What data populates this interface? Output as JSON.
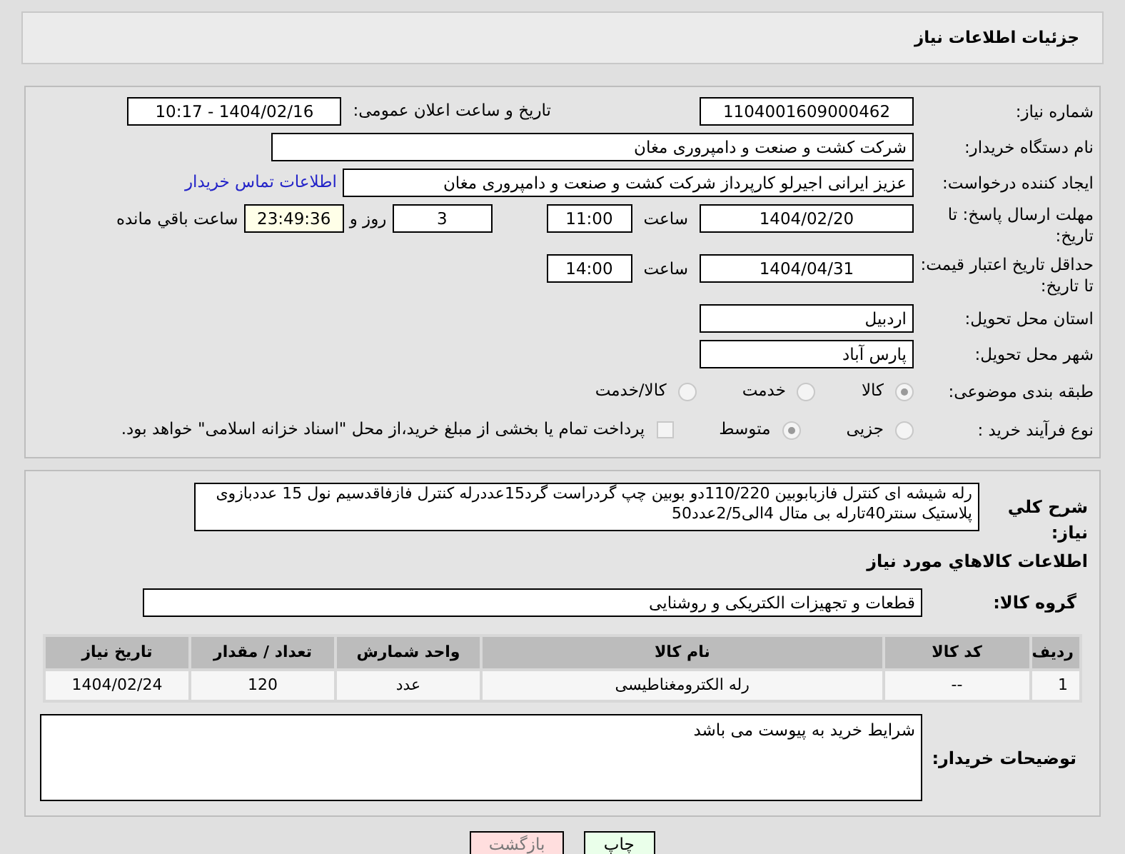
{
  "header": {
    "title": "جزئیات اطلاعات نیاز"
  },
  "need_number": {
    "label": "شماره نیاز:",
    "value": "1104001609000462"
  },
  "announce": {
    "label": "تاریخ و ساعت اعلان عمومی:",
    "value": "1404/02/16 - 10:17"
  },
  "buyer_org": {
    "label": "نام دستگاه خریدار:",
    "value": "شرکت کشت و صنعت و دامپروری مغان"
  },
  "creator": {
    "label": "ایجاد کننده درخواست:",
    "value": "عزیز ایرانی اجیرلو کارپرداز شرکت کشت و صنعت و دامپروری مغان",
    "link": "اطلاعات تماس خریدار"
  },
  "response_deadline": {
    "label": "مهلت ارسال پاسخ: تا تاریخ:",
    "date": "1404/02/20",
    "time_label": "ساعت",
    "time": "11:00",
    "days": "3",
    "days_label": "روز و",
    "remaining": "23:49:36",
    "remaining_label": "ساعت باقي مانده"
  },
  "price_validity": {
    "label": "حداقل تاریخ اعتبار قیمت: تا تاریخ:",
    "date": "1404/04/31",
    "time_label": "ساعت",
    "time": "14:00"
  },
  "province": {
    "label": "استان محل تحویل:",
    "value": "اردبیل"
  },
  "city": {
    "label": "شهر محل تحویل:",
    "value": "پارس آباد"
  },
  "category": {
    "label": "طبقه بندی موضوعی:",
    "options": [
      {
        "label": "کالا",
        "selected": true
      },
      {
        "label": "خدمت",
        "selected": false
      },
      {
        "label": "کالا/خدمت",
        "selected": false
      }
    ]
  },
  "process": {
    "label": "نوع فرآیند خرید :",
    "options": [
      {
        "label": "جزیی",
        "selected": false
      },
      {
        "label": "متوسط",
        "selected": true
      }
    ],
    "treasury": {
      "label": "پرداخت تمام یا بخشی از مبلغ خرید،از محل \"اسناد خزانه اسلامی\" خواهد بود.",
      "checked": false
    }
  },
  "description": {
    "label": "شرح کلي نياز:",
    "value": "رله شیشه ای کنترل فازبابوبین 110/220دو بوبین چپ گردراست گرد15عددرله کنترل فازفاقدسیم نول 15 عددبازوی پلاستیک  سنتر40تارله بی متال 4الی2/5عدد50"
  },
  "items_title": "اطلاعات کالاهاي مورد نياز",
  "goods_group": {
    "label": "گروه کالا:",
    "value": "قطعات و تجهیزات الکتریکی و روشنایی"
  },
  "table": {
    "columns": [
      "ردیف",
      "کد کالا",
      "نام کالا",
      "واحد شمارش",
      "تعداد / مقدار",
      "تاریخ نیاز"
    ],
    "rows": [
      [
        "1",
        "--",
        "رله الکترومغناطیسی",
        "عدد",
        "120",
        "1404/02/24"
      ]
    ]
  },
  "buyer_notes": {
    "label": "توضیحات خریدار:",
    "value": "شرایط خرید به پیوست می باشد"
  },
  "buttons": [
    {
      "label": "چاپ",
      "kind": "print"
    },
    {
      "label": "بازگشت",
      "kind": "back"
    }
  ]
}
